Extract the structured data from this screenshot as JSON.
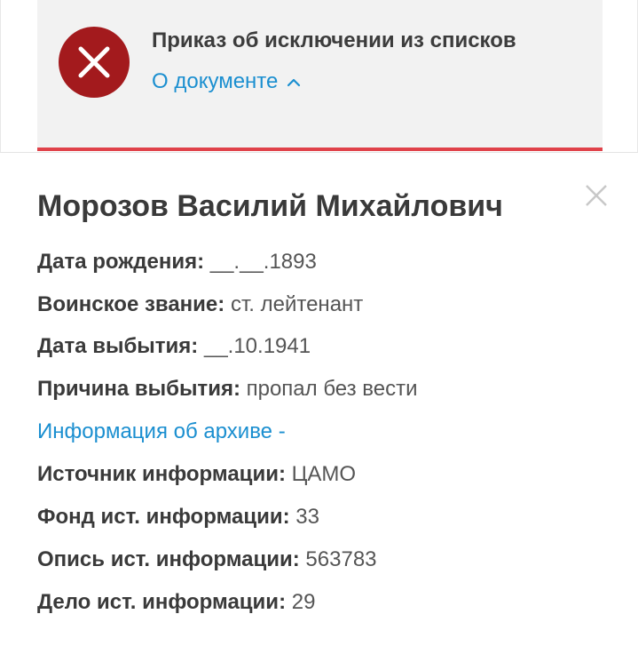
{
  "document": {
    "title": "Приказ об исключении из списков",
    "link_label": "О документе",
    "icon": "close-x-icon",
    "status_color": "#a31a1d"
  },
  "person": {
    "name": "Морозов Василий Михайлович",
    "fields": [
      {
        "label": "Дата рождения:",
        "value": "__.__.1893"
      },
      {
        "label": "Воинское звание:",
        "value": "ст. лейтенант"
      },
      {
        "label": "Дата выбытия:",
        "value": "__.10.1941"
      },
      {
        "label": "Причина выбытия:",
        "value": "пропал без вести"
      }
    ],
    "archive_link": "Информация об архиве -",
    "archive_fields": [
      {
        "label": "Источник информации:",
        "value": "ЦАМО"
      },
      {
        "label": "Фонд ист. информации:",
        "value": "33"
      },
      {
        "label": "Опись ист. информации:",
        "value": "563783"
      },
      {
        "label": "Дело ист. информации:",
        "value": "29"
      }
    ]
  },
  "colors": {
    "accent_red": "#e0424a",
    "link_blue": "#1b8fd0"
  }
}
